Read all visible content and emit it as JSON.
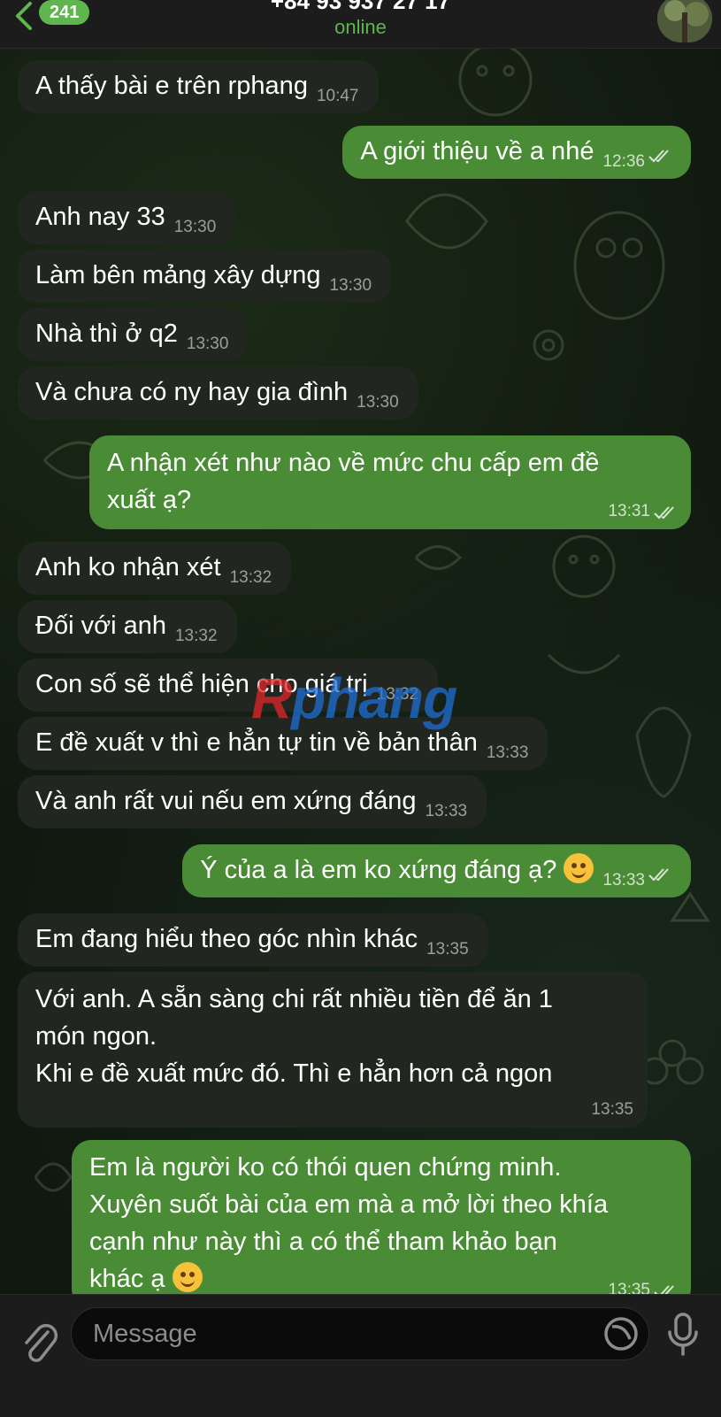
{
  "header": {
    "back_count": "241",
    "contact_name": "+84 93 937 27 17",
    "status": "online"
  },
  "messages": [
    {
      "dir": "in",
      "text": "A thấy bài e trên rphang",
      "time": "10:47"
    },
    {
      "dir": "out",
      "text": "A giới thiệu về a nhé",
      "time": "12:36"
    },
    {
      "dir": "in",
      "text": "Anh nay 33",
      "time": "13:30"
    },
    {
      "dir": "in",
      "text": "Làm bên mảng xây dựng",
      "time": "13:30"
    },
    {
      "dir": "in",
      "text": "Nhà thì ở q2",
      "time": "13:30"
    },
    {
      "dir": "in",
      "text": "Và chưa có ny hay gia đình",
      "time": "13:30"
    },
    {
      "dir": "out",
      "lines": [
        "A nhận xét như nào về mức chu cấp em đề",
        "xuất ạ?"
      ],
      "time": "13:31"
    },
    {
      "dir": "in",
      "text": "Anh ko nhận xét",
      "time": "13:32"
    },
    {
      "dir": "in",
      "text": "Đối với anh",
      "time": "13:32"
    },
    {
      "dir": "in",
      "text": "Con số sẽ thể hiện cho giá trị",
      "time": "13:32"
    },
    {
      "dir": "in",
      "text": "E đề xuất v thì e hẳn tự tin về bản thân",
      "time": "13:33"
    },
    {
      "dir": "in",
      "text": "Và anh rất vui nếu em xứng đáng",
      "time": "13:33"
    },
    {
      "dir": "out",
      "text": "Ý của a là em ko xứng đáng ạ?",
      "emoji": "smiling-face",
      "time": "13:33"
    },
    {
      "dir": "in",
      "text": "Em đang hiểu theo góc nhìn khác",
      "time": "13:35"
    },
    {
      "dir": "in",
      "lines": [
        "Với anh. A sẵn sàng chi rất nhiều tiền để ăn 1",
        "món ngon.",
        "Khi e đề xuất mức đó. Thì e hẳn hơn cả ngon"
      ],
      "time": "13:35"
    },
    {
      "dir": "out",
      "lines": [
        "Em là người ko có thói quen chứng minh.",
        "Xuyên suốt bài của em mà a mở lời theo khía",
        "cạnh như này thì a có thể tham khảo bạn",
        "khác ạ"
      ],
      "emoji": "smiling-face",
      "time": "13:35"
    }
  ],
  "watermark": {
    "part1": "R",
    "part2": "phang"
  },
  "composer": {
    "placeholder": "Message"
  },
  "colors": {
    "accent": "#5fb54e",
    "incoming_bubble": "#212621",
    "outgoing_bubble": "#4a8c35",
    "header_bg": "#1c1c1d"
  }
}
